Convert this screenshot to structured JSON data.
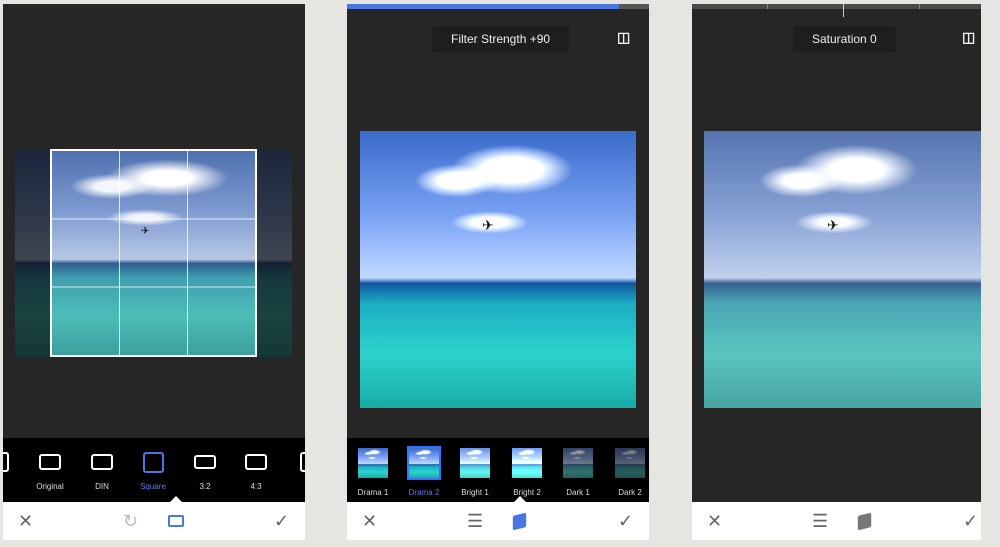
{
  "panel_crop": {
    "aspect_options": [
      {
        "label": "e",
        "selected": false
      },
      {
        "label": "Original",
        "selected": false
      },
      {
        "label": "DIN",
        "selected": false
      },
      {
        "label": "Square",
        "selected": true
      },
      {
        "label": "3:2",
        "selected": false
      },
      {
        "label": "4:3",
        "selected": false
      }
    ],
    "bottom_icons": [
      "close-icon",
      "rotate-icon",
      "aspect-ratio-icon",
      "check-icon"
    ]
  },
  "panel_filter": {
    "value_label": "Filter Strength +90",
    "strength_progress_percent": 90,
    "filters": [
      {
        "label": "Drama 1",
        "selected": false
      },
      {
        "label": "Drama 2",
        "selected": true
      },
      {
        "label": "Bright 1",
        "selected": false
      },
      {
        "label": "Bright 2",
        "selected": false
      },
      {
        "label": "Dark 1",
        "selected": false
      },
      {
        "label": "Dark 2",
        "selected": false
      }
    ],
    "bottom_icons": [
      "close-icon",
      "sliders-icon",
      "styles-icon",
      "check-icon"
    ]
  },
  "panel_saturation": {
    "value_label": "Saturation 0",
    "bottom_icons": [
      "close-icon",
      "sliders-icon",
      "styles-icon",
      "check-icon"
    ]
  },
  "colors": {
    "accent": "#4a76e0",
    "selected_text": "#5b7de0",
    "background": "#e7e5e2",
    "panel": "#262626"
  },
  "glyphs": {
    "close": "✕",
    "check": "✓",
    "rotate": "↻",
    "compare": "◫",
    "sliders": "☰",
    "plane": "✈"
  }
}
